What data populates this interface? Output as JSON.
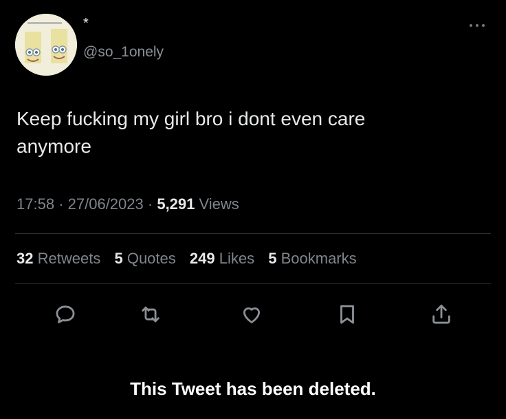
{
  "author": {
    "display_name": "*",
    "handle": "@so_1onely"
  },
  "tweet": {
    "text": "Keep fucking my girl bro i dont even care anymore",
    "time": "17:58",
    "date": "27/06/2023",
    "views_count": "5,291",
    "views_label": "Views"
  },
  "stats": {
    "retweets": {
      "count": "32",
      "label": "Retweets"
    },
    "quotes": {
      "count": "5",
      "label": "Quotes"
    },
    "likes": {
      "count": "249",
      "label": "Likes"
    },
    "bookmarks": {
      "count": "5",
      "label": "Bookmarks"
    }
  },
  "actions": [
    "reply-icon",
    "retweet-icon",
    "like-icon",
    "bookmark-icon",
    "share-icon"
  ],
  "deleted_notice": "This Tweet has been deleted.",
  "colors": {
    "background": "#000000",
    "primary_text": "#e7e9ea",
    "secondary_text": "#7f858b",
    "divider": "#2c2f33"
  }
}
